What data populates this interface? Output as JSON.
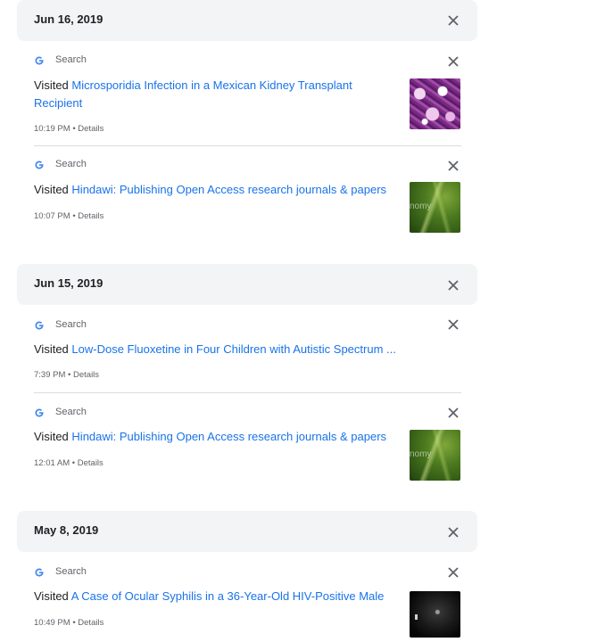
{
  "groups": [
    {
      "date": "Jun 16, 2019",
      "items": [
        {
          "source": "Search",
          "visited_prefix": "Visited",
          "title_line1": "Microsporidia Infection in a Mexican Kidney Transplant",
          "title_line2": "Recipient",
          "time": "10:19 PM",
          "details": "Details",
          "thumbnail": "purple-microscopy-image"
        },
        {
          "source": "Search",
          "visited_prefix": "Visited",
          "title": "Hindawi: Publishing Open Access research journals & papers",
          "time": "10:07 PM",
          "details": "Details",
          "thumbnail": "green-wheat-image",
          "thumbnail_text": "nomy"
        }
      ]
    },
    {
      "date": "Jun 15, 2019",
      "items": [
        {
          "source": "Search",
          "visited_prefix": "Visited",
          "title": "Low-Dose Fluoxetine in Four Children with Autistic Spectrum ...",
          "time": "7:39 PM",
          "details": "Details"
        },
        {
          "source": "Search",
          "visited_prefix": "Visited",
          "title": "Hindawi: Publishing Open Access research journals & papers",
          "time": "12:01 AM",
          "details": "Details",
          "thumbnail": "green-wheat-image",
          "thumbnail_text": "nomy"
        }
      ]
    },
    {
      "date": "May 8, 2019",
      "items": [
        {
          "source": "Search",
          "visited_prefix": "Visited",
          "title": "A Case of Ocular Syphilis in a 36-Year-Old HIV-Positive Male",
          "time": "10:49 PM",
          "details": "Details",
          "thumbnail": "dark-eye-scan-image"
        }
      ]
    }
  ],
  "separator": "•",
  "colors": {
    "link": "#1a73e8",
    "header_bg": "#f3f4f6",
    "muted": "#5f6368",
    "text": "#202124"
  },
  "icons": {
    "source": "google-g-icon",
    "remove": "close-icon"
  }
}
